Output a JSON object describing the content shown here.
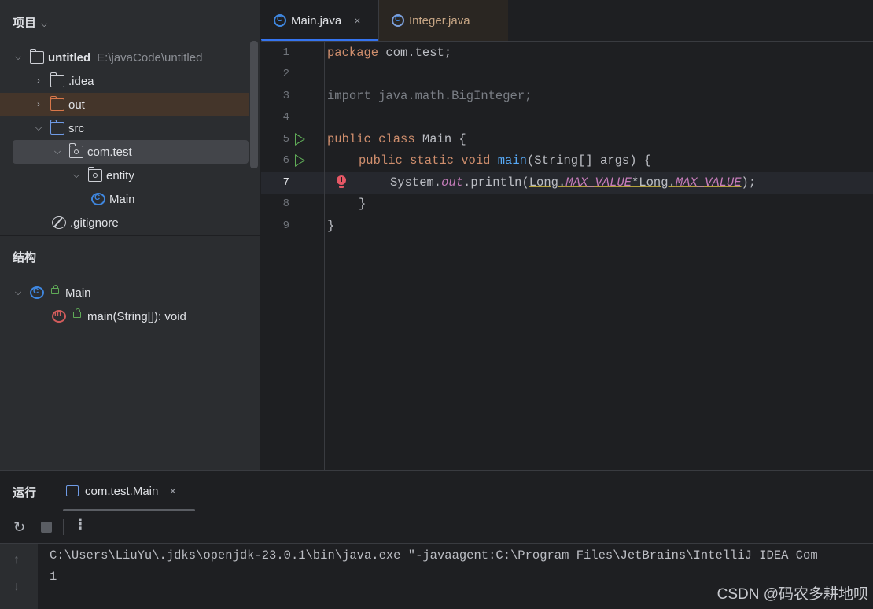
{
  "project_panel": {
    "title": "项目",
    "tree": [
      {
        "label": "untitled",
        "path": "E:\\javaCode\\untitled"
      },
      {
        "label": ".idea"
      },
      {
        "label": "out"
      },
      {
        "label": "src"
      },
      {
        "label": "com.test"
      },
      {
        "label": "entity"
      },
      {
        "label": "Main"
      },
      {
        "label": ".gitignore"
      }
    ]
  },
  "structure_panel": {
    "title": "结构",
    "items": [
      {
        "label": "Main"
      },
      {
        "label": "main(String[]): void"
      }
    ]
  },
  "tabs": [
    {
      "label": "Main.java",
      "active": true,
      "close": "×"
    },
    {
      "label": "Integer.java",
      "active": false
    }
  ],
  "editor": {
    "line_numbers": [
      "1",
      "2",
      "3",
      "4",
      "5",
      "6",
      "7",
      "8",
      "9"
    ],
    "lines": {
      "l1_kw": "package",
      "l1_rest": " com.test;",
      "l3": "import java.math.BigInteger;",
      "l5_kw": "public class",
      "l5_rest": " Main {",
      "l6_kw": "public static void",
      "l6_fn": "main",
      "l6_rest": "(String[] args) {",
      "l7_a": "System.",
      "l7_out": "out",
      "l7_b": ".println(",
      "l7_long1": "Long.",
      "l7_max1": "MAX_VALUE",
      "l7_mul": "*",
      "l7_long2": "Long.",
      "l7_max2": "MAX_VALUE",
      "l7_end": ");",
      "l8": "}",
      "l9": "}"
    }
  },
  "run_panel": {
    "title": "运行",
    "tab_label": "com.test.Main",
    "tab_close": "×",
    "rerun_icon": "rerun-icon",
    "more_icon": "⋮",
    "output": [
      "C:\\Users\\LiuYu\\.jdks\\openjdk-23.0.1\\bin\\java.exe \"-javaagent:C:\\Program Files\\JetBrains\\IntelliJ IDEA Com",
      "1"
    ],
    "up_arrow": "↑",
    "down_arrow": "↓"
  },
  "watermark": "CSDN @码农多耕地呗",
  "colors": {
    "keyword": "#cf8e6d",
    "function": "#56a8f5",
    "static_field": "#c77dbb",
    "accent": "#3574f0",
    "run_green": "#5faa57",
    "error_red": "#e55765"
  }
}
